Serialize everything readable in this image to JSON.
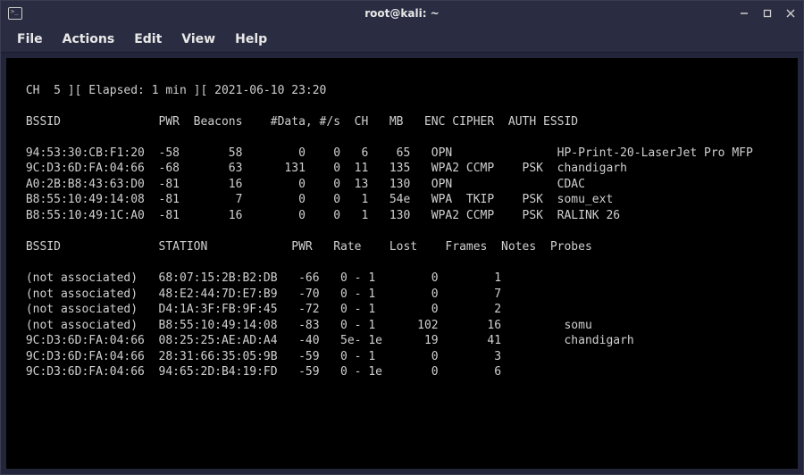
{
  "window": {
    "title": "root@kali: ~"
  },
  "menu": {
    "file": "File",
    "actions": "Actions",
    "edit": "Edit",
    "view": "View",
    "help": "Help"
  },
  "airodump": {
    "status_line": " CH  5 ][ Elapsed: 1 min ][ 2021-06-10 23:20",
    "channel": 5,
    "elapsed": "1 min",
    "timestamp": "2021-06-10 23:20",
    "ap_header": " BSSID              PWR  Beacons    #Data, #/s  CH   MB   ENC CIPHER  AUTH ESSID",
    "aps": [
      {
        "bssid": "94:53:30:CB:F1:20",
        "pwr": -58,
        "beacons": 58,
        "data": 0,
        "ps": 0,
        "ch": 6,
        "mb": "65",
        "enc": "OPN",
        "cipher": "",
        "auth": "",
        "essid": "HP-Print-20-LaserJet Pro MFP"
      },
      {
        "bssid": "9C:D3:6D:FA:04:66",
        "pwr": -68,
        "beacons": 63,
        "data": 131,
        "ps": 0,
        "ch": 11,
        "mb": "135",
        "enc": "WPA2",
        "cipher": "CCMP",
        "auth": "PSK",
        "essid": "chandigarh"
      },
      {
        "bssid": "A0:2B:B8:43:63:D0",
        "pwr": -81,
        "beacons": 16,
        "data": 0,
        "ps": 0,
        "ch": 13,
        "mb": "130",
        "enc": "OPN",
        "cipher": "",
        "auth": "",
        "essid": "CDAC"
      },
      {
        "bssid": "B8:55:10:49:14:08",
        "pwr": -81,
        "beacons": 7,
        "data": 0,
        "ps": 0,
        "ch": 1,
        "mb": "54e",
        "enc": "WPA",
        "cipher": "TKIP",
        "auth": "PSK",
        "essid": "somu_ext"
      },
      {
        "bssid": "B8:55:10:49:1C:A0",
        "pwr": -81,
        "beacons": 16,
        "data": 0,
        "ps": 0,
        "ch": 1,
        "mb": "130",
        "enc": "WPA2",
        "cipher": "CCMP",
        "auth": "PSK",
        "essid": "RALINK 26"
      }
    ],
    "station_header": " BSSID              STATION            PWR   Rate    Lost    Frames  Notes  Probes",
    "stations": [
      {
        "bssid": "(not associated)",
        "station": "68:07:15:2B:B2:DB",
        "pwr": -66,
        "rate": "0 - 1",
        "lost": 0,
        "frames": 1,
        "notes": "",
        "probes": ""
      },
      {
        "bssid": "(not associated)",
        "station": "48:E2:44:7D:E7:B9",
        "pwr": -70,
        "rate": "0 - 1",
        "lost": 0,
        "frames": 7,
        "notes": "",
        "probes": ""
      },
      {
        "bssid": "(not associated)",
        "station": "D4:1A:3F:FB:9F:45",
        "pwr": -72,
        "rate": "0 - 1",
        "lost": 0,
        "frames": 2,
        "notes": "",
        "probes": ""
      },
      {
        "bssid": "(not associated)",
        "station": "B8:55:10:49:14:08",
        "pwr": -83,
        "rate": "0 - 1",
        "lost": 102,
        "frames": 16,
        "notes": "",
        "probes": "somu"
      },
      {
        "bssid": "9C:D3:6D:FA:04:66",
        "station": "08:25:25:AE:AD:A4",
        "pwr": -40,
        "rate": "5e- 1e",
        "lost": 19,
        "frames": 41,
        "notes": "",
        "probes": "chandigarh"
      },
      {
        "bssid": "9C:D3:6D:FA:04:66",
        "station": "28:31:66:35:05:9B",
        "pwr": -59,
        "rate": "0 - 1",
        "lost": 0,
        "frames": 3,
        "notes": "",
        "probes": ""
      },
      {
        "bssid": "9C:D3:6D:FA:04:66",
        "station": "94:65:2D:B4:19:FD",
        "pwr": -59,
        "rate": "0 - 1e",
        "lost": 0,
        "frames": 6,
        "notes": "",
        "probes": ""
      }
    ]
  }
}
